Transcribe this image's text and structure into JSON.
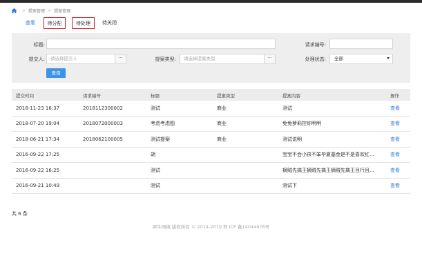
{
  "breadcrumb": {
    "items": [
      "提案管理",
      "提案管理"
    ],
    "separator": ">"
  },
  "tabs": [
    {
      "label": "查看",
      "style": "link"
    },
    {
      "label": "待分配",
      "style": "boxed"
    },
    {
      "label": "待处理",
      "style": "boxed"
    },
    {
      "label": "待关闭",
      "style": "dark"
    }
  ],
  "filters": {
    "title_label": "标题:",
    "request_no_label": "请求编号:",
    "submitter_label": "提交人:",
    "submitter_placeholder": "请选择提交人",
    "proposal_type_label": "提案类型:",
    "proposal_type_placeholder": "请选择提案类型",
    "status_label": "处理状态:",
    "status_value": "全部",
    "picker_button": "···",
    "query_button": "查询"
  },
  "table": {
    "headers": [
      "提交时间",
      "请求编号",
      "标题",
      "提案类型",
      "提案内容",
      "操作"
    ],
    "rows": [
      {
        "time": "2018-11-23 16:37",
        "no": "2018112300002",
        "title": "测试",
        "type": "商业",
        "content": "测试",
        "op": "查看"
      },
      {
        "time": "2018-07-20 19:04",
        "no": "2018072000003",
        "title": "考虑考虑图",
        "type": "商业",
        "content": "免免萝莉控你明明",
        "op": "查看"
      },
      {
        "time": "2018-06-21 17:34",
        "no": "2018062100005",
        "title": "测试提案",
        "type": "商业",
        "content": "测试说明",
        "op": "查看"
      },
      {
        "time": "2016-09-22 17:25",
        "no": "",
        "title": "胡",
        "type": "",
        "content": "宝宝不会小孩不笨毕夏基金是不是喜欢红...",
        "op": "查看"
      },
      {
        "time": "2016-09-22 16:25",
        "no": "",
        "title": "测试",
        "type": "",
        "content": "摘贼先擒王摘贼先擒王摘贼先擒王且行且...",
        "op": "查看"
      },
      {
        "time": "2016-09-21 10:49",
        "no": "",
        "title": "测试",
        "type": "",
        "content": "测试下",
        "op": "查看"
      }
    ]
  },
  "total_text": "共 6 条",
  "footer_text": "犀牛网络 版权所有 © 2014-2019    苏 ICP 备14044978号",
  "colors": {
    "accent": "#2f7cd6",
    "query_button": "#3d93e8",
    "tab_highlight_border": "#d0141e",
    "filter_background": "#eeeeee",
    "table_header_background": "#ececec"
  }
}
